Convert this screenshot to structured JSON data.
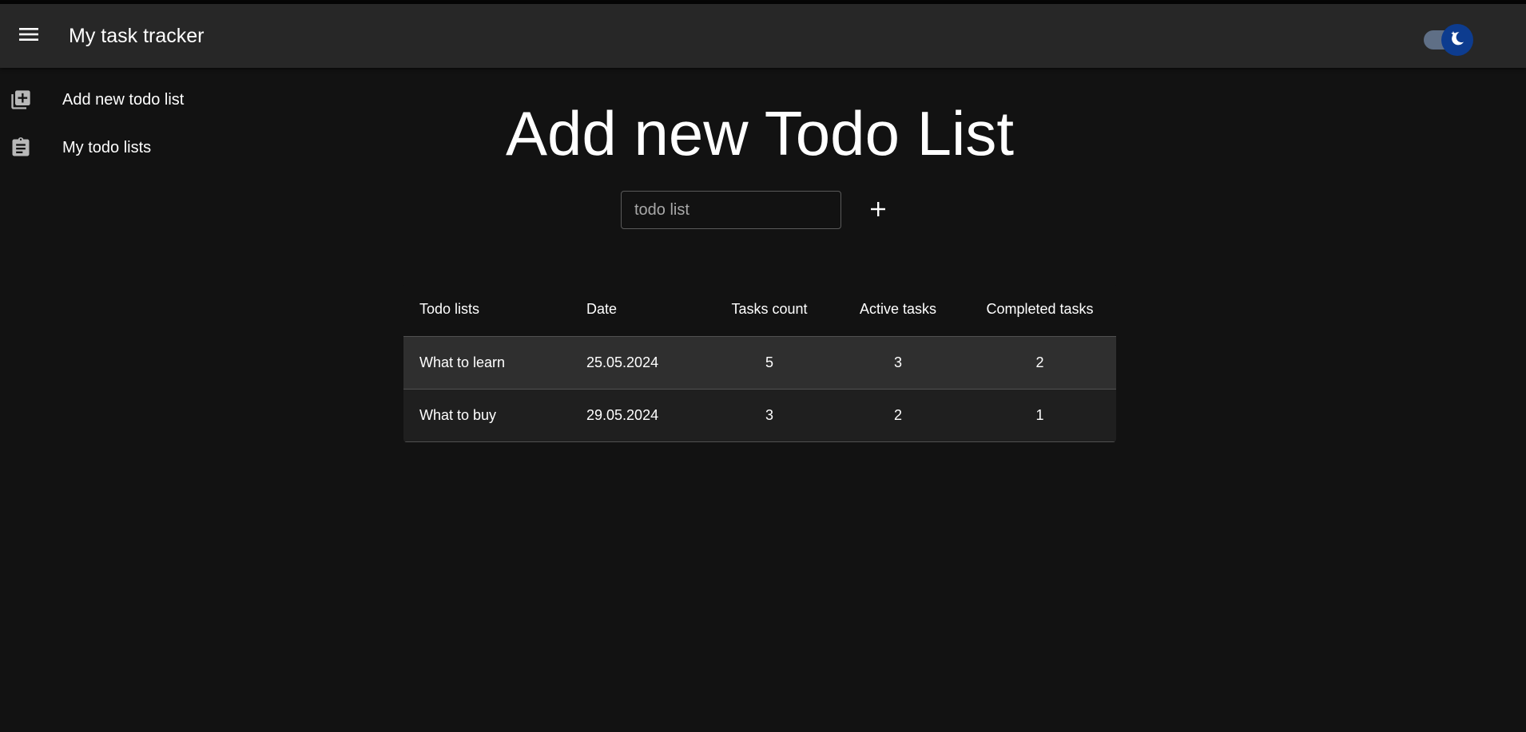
{
  "header": {
    "title": "My task tracker",
    "menu_icon": "menu-icon",
    "theme_toggle": {
      "state": "dark",
      "icon": "moon-icon"
    }
  },
  "sidebar": {
    "items": [
      {
        "label": "Add new todo list",
        "icon": "library-add-icon"
      },
      {
        "label": "My todo lists",
        "icon": "clipboard-icon"
      }
    ]
  },
  "main": {
    "title": "Add new Todo List",
    "input": {
      "placeholder": "todo list",
      "value": ""
    },
    "add_icon": "plus-icon"
  },
  "table": {
    "columns": [
      "Todo lists",
      "Date",
      "Tasks count",
      "Active tasks",
      "Completed tasks"
    ],
    "rows": [
      [
        "What to learn",
        "25.05.2024",
        "5",
        "3",
        "2"
      ],
      [
        "What to buy",
        "29.05.2024",
        "3",
        "2",
        "1"
      ]
    ]
  },
  "colors": {
    "background": "#121212",
    "appbar": "#272727",
    "toggle_thumb": "#0d3c8f",
    "row_highlight": "#2f2f2f"
  }
}
